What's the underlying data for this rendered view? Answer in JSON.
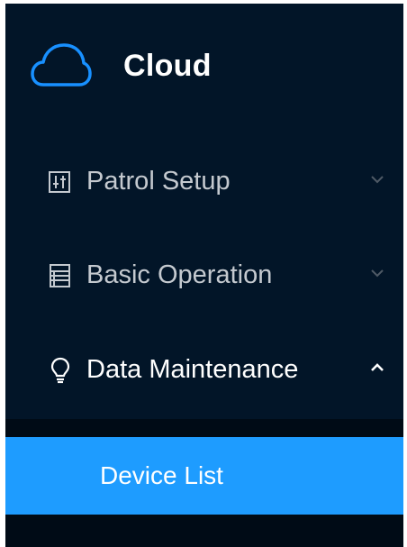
{
  "logo": {
    "icon": "cloud-icon",
    "title": "Cloud"
  },
  "menu": {
    "items": [
      {
        "label": "Patrol Setup",
        "icon": "sliders-icon",
        "expanded": false
      },
      {
        "label": "Basic Operation",
        "icon": "list-icon",
        "expanded": false
      },
      {
        "label": "Data Maintenance",
        "icon": "bulb-icon",
        "expanded": true
      }
    ],
    "submenu": {
      "items": [
        {
          "label": "Device List",
          "selected": true
        }
      ]
    }
  },
  "colors": {
    "sidebar_bg": "#021528",
    "submenu_bg": "#000b16",
    "selected_bg": "#1e9cff",
    "logo_icon": "#1890ff",
    "text_active": "#ffffff",
    "text_muted": "#c4c9cf"
  }
}
